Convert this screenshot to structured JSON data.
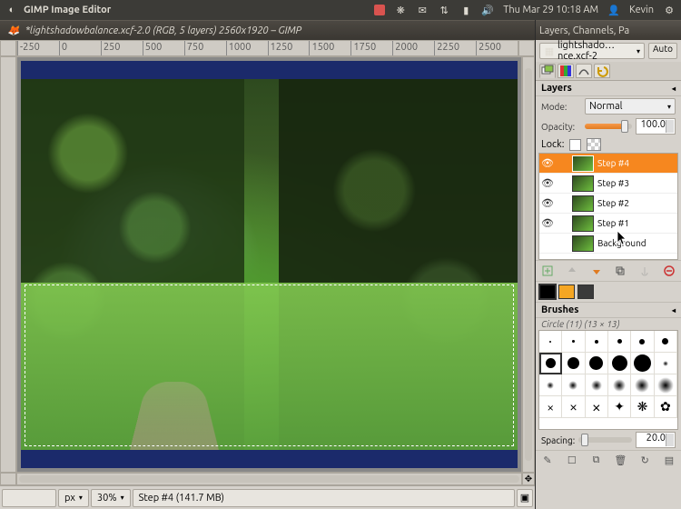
{
  "menubar": {
    "app_name": "GIMP Image Editor",
    "datetime": "Thu Mar 29 10:18 AM",
    "user": "Kevin"
  },
  "image_window": {
    "title": "*lightshadowbalance.xcf-2.0 (RGB, 5 layers) 2560x1920 – GIMP",
    "ruler_ticks": [
      "-250",
      "0",
      "250",
      "500",
      "750",
      "1000",
      "1250",
      "1500",
      "1750",
      "2000",
      "2250",
      "2500"
    ],
    "status": {
      "unit": "px",
      "zoom": "30%",
      "layer_info": "Step #4 (141.7 MB)"
    }
  },
  "dock": {
    "title": "Layers, Channels, Pa",
    "image_selector": "lightshado…nce.xcf-2",
    "auto_label": "Auto",
    "layers_panel": {
      "title": "Layers",
      "mode_label": "Mode:",
      "mode_value": "Normal",
      "opacity_label": "Opacity:",
      "opacity_value": "100.0",
      "lock_label": "Lock:",
      "layers": [
        {
          "name": "Step #4",
          "visible": true,
          "active": true
        },
        {
          "name": "Step #3",
          "visible": true,
          "active": false
        },
        {
          "name": "Step #2",
          "visible": true,
          "active": false
        },
        {
          "name": "Step #1",
          "visible": true,
          "active": false
        },
        {
          "name": "Background",
          "visible": false,
          "active": false
        }
      ]
    },
    "colors": {
      "swatches": [
        "#000000",
        "#f5a623",
        "#3a3a3a"
      ]
    },
    "brushes_panel": {
      "title": "Brushes",
      "current": "Circle (11) (13 × 13)",
      "spacing_label": "Spacing:",
      "spacing_value": "20.0"
    }
  }
}
